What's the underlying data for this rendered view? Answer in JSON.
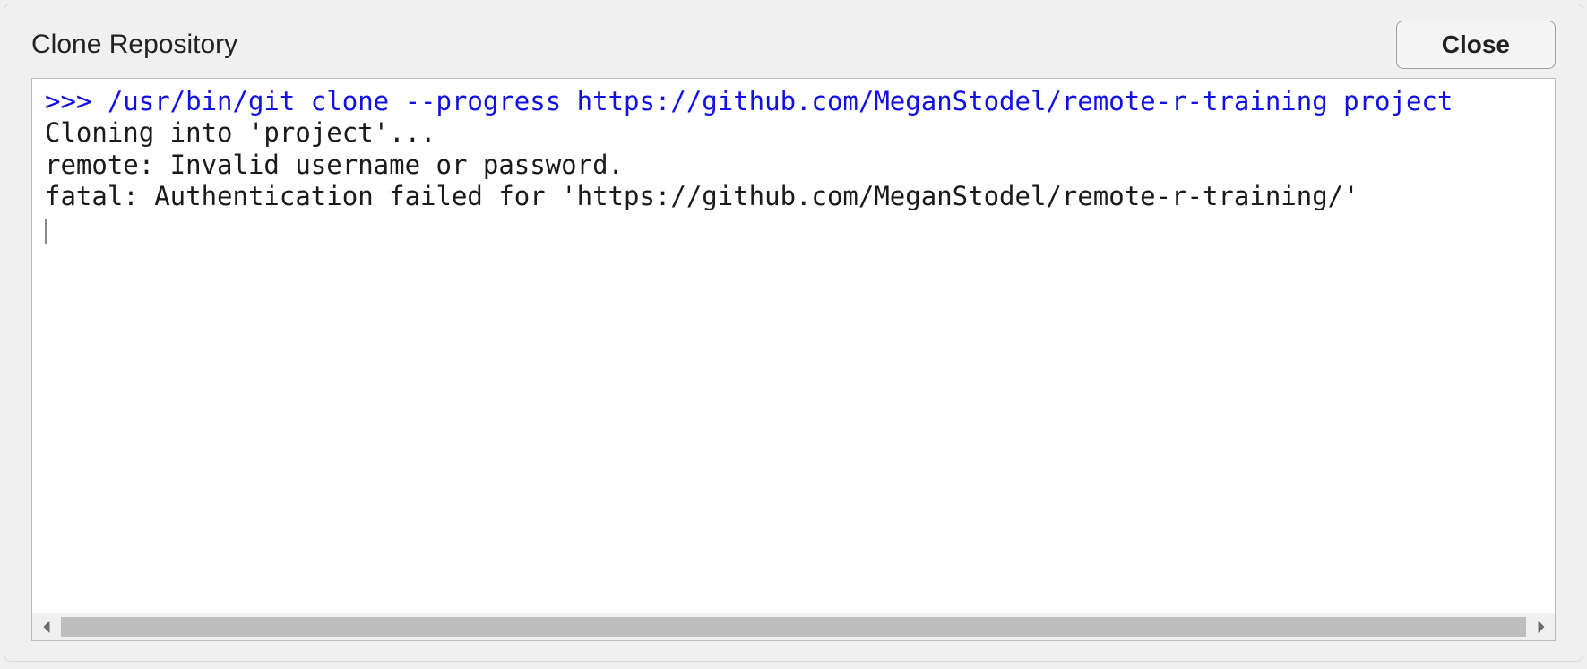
{
  "dialog": {
    "title": "Clone Repository",
    "close_label": "Close"
  },
  "console": {
    "command_line": ">>> /usr/bin/git clone --progress https://github.com/MeganStodel/remote-r-training project",
    "lines": [
      "Cloning into 'project'...",
      "remote: Invalid username or password.",
      "fatal: Authentication failed for 'https://github.com/MeganStodel/remote-r-training/'"
    ]
  }
}
